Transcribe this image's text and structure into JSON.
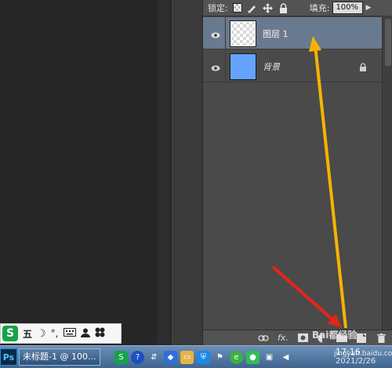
{
  "layers_panel": {
    "lock_label": "锁定:",
    "fill_label": "填充:",
    "fill_value": "100%",
    "layers": [
      {
        "name": "图层 1",
        "type": "transparent",
        "selected": true
      },
      {
        "name": "背景",
        "type": "background",
        "selected": false,
        "locked": true
      }
    ]
  },
  "ime_bar": {
    "logo": "S",
    "mode": "五"
  },
  "taskbar": {
    "ps_label": "Ps",
    "active_window": "未标题-1 @ 100...",
    "clock_time": "17:16",
    "clock_date": "2021/2/26"
  },
  "watermark": {
    "brand": "Bai都经验",
    "url": "jingyan.baidu.com"
  },
  "colors": {
    "background_layer_thumb": "#66a3ff",
    "annotation_arrow_yellow": "#f5b400",
    "annotation_arrow_red": "#e8241a"
  }
}
